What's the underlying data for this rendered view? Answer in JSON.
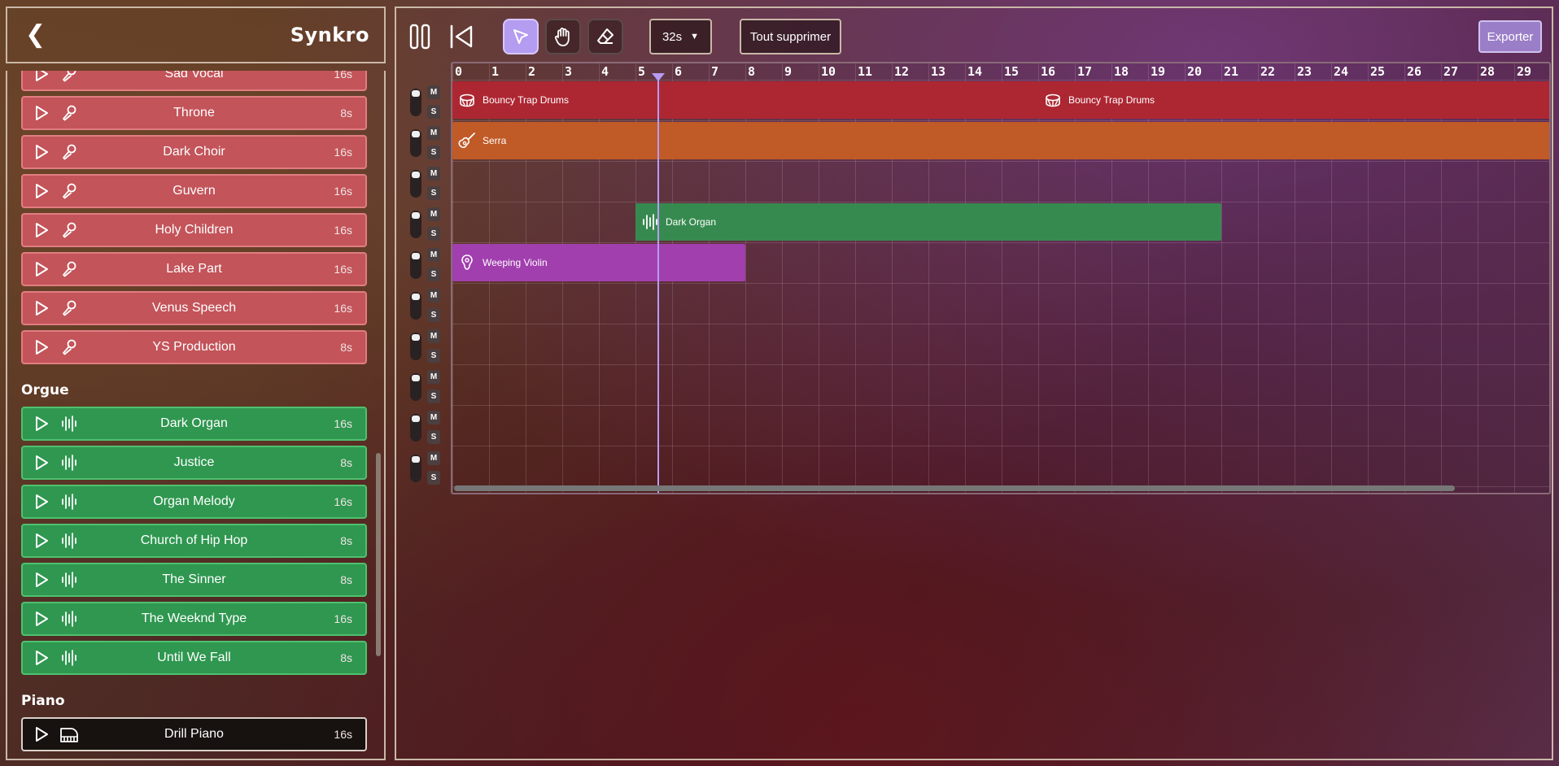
{
  "app": {
    "title": "Synkro"
  },
  "sidebar": {
    "groups": [
      {
        "items": [
          {
            "name": "Sad Vocal",
            "duration": "16s"
          },
          {
            "name": "Throne",
            "duration": "8s"
          },
          {
            "name": "Dark Choir",
            "duration": "16s"
          },
          {
            "name": "Guvern",
            "duration": "16s"
          },
          {
            "name": "Holy Children",
            "duration": "16s"
          },
          {
            "name": "Lake Part",
            "duration": "16s"
          },
          {
            "name": "Venus Speech",
            "duration": "16s"
          },
          {
            "name": "YS Production",
            "duration": "8s"
          }
        ]
      },
      {
        "title": "Orgue",
        "items": [
          {
            "name": "Dark Organ",
            "duration": "16s"
          },
          {
            "name": "Justice",
            "duration": "8s"
          },
          {
            "name": "Organ Melody",
            "duration": "16s"
          },
          {
            "name": "Church of Hip Hop",
            "duration": "8s"
          },
          {
            "name": "The Sinner",
            "duration": "8s"
          },
          {
            "name": "The Weeknd Type",
            "duration": "16s"
          },
          {
            "name": "Until We Fall",
            "duration": "8s"
          }
        ]
      },
      {
        "title": "Piano",
        "items": [
          {
            "name": "Drill Piano",
            "duration": "16s"
          }
        ]
      }
    ]
  },
  "toolbar": {
    "zoom_value": "32s",
    "clear_label": "Tout supprimer",
    "export_label": "Exporter",
    "mute_label": "M",
    "solo_label": "S"
  },
  "timeline": {
    "ticks": [
      "0",
      "1",
      "2",
      "3",
      "4",
      "5",
      "6",
      "7",
      "8",
      "9",
      "10",
      "11",
      "12",
      "13",
      "14",
      "15",
      "16",
      "17",
      "18",
      "19",
      "20",
      "21",
      "22",
      "23",
      "24",
      "25",
      "26",
      "27",
      "28",
      "29"
    ],
    "playhead_time": 5.6,
    "tracks": 10,
    "clips": [
      {
        "label": "Bouncy Trap Drums",
        "track": 0,
        "start": 0,
        "end": 16,
        "icon": "drum-icon",
        "color": "#ad2733"
      },
      {
        "label": "Bouncy Trap Drums",
        "track": 0,
        "start": 16,
        "end": 30,
        "icon": "drum-icon",
        "color": "#ad2733"
      },
      {
        "label": "Serra",
        "track": 1,
        "start": 0,
        "end": 30,
        "icon": "guitar-icon",
        "color": "#c05a27"
      },
      {
        "label": "Dark Organ",
        "track": 3,
        "start": 5,
        "end": 21,
        "icon": "organ-icon",
        "color": "#378a4f"
      },
      {
        "label": "Weeping Violin",
        "track": 4,
        "start": 0,
        "end": 8,
        "icon": "violin-icon",
        "color": "#a13fae"
      }
    ]
  }
}
